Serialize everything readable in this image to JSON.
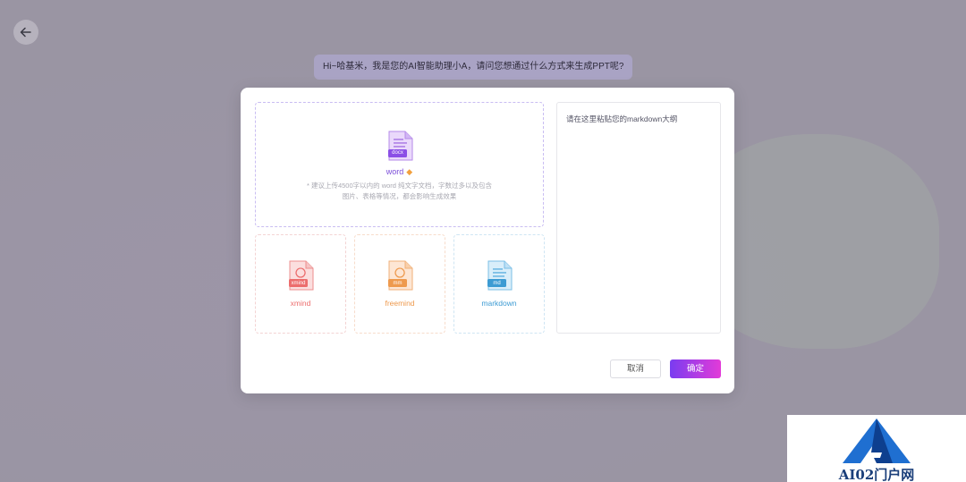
{
  "page": {
    "back_icon": "arrow-left-icon"
  },
  "chat": {
    "message": "Hi~哈基米，我是您的AI智能助理小A，请问您想通过什么方式来生成PPT呢?"
  },
  "modal": {
    "word": {
      "badge": "docx",
      "label": "word",
      "vip_icon": "diamond-icon",
      "hint_line1": "* 建议上传4500字以内的 word 纯文字文档，字数过多以及包含",
      "hint_line2": "图片、表格等情况，都会影响生成效果"
    },
    "options": [
      {
        "label": "xmind",
        "badge": "xmind",
        "color": "#ec6d6d"
      },
      {
        "label": "freemind",
        "badge": "mm",
        "color": "#ee9a4e"
      },
      {
        "label": "markdown",
        "badge": "md",
        "color": "#3c9bd3"
      }
    ],
    "markdown_placeholder": "请在这里粘贴您的markdown大纲",
    "cancel_label": "取消",
    "confirm_label": "确定"
  },
  "watermark": {
    "text": "AI02门户网"
  }
}
